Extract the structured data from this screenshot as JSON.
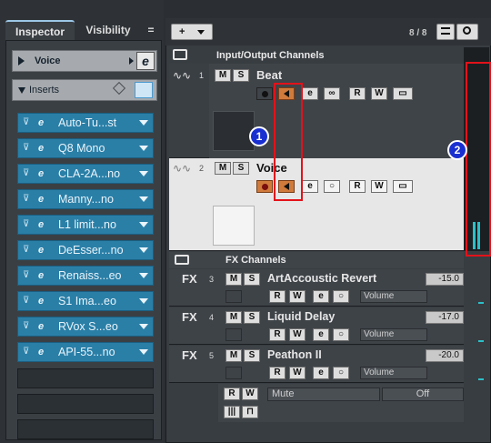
{
  "inspector": {
    "tabs": [
      "Inspector",
      "Visibility"
    ],
    "menu_glyph": "=",
    "track_label": "Voice",
    "inserts_label": "Inserts",
    "inserts": [
      "Auto-Tu...st",
      "Q8 Mono",
      "CLA-2A...no",
      "Manny...no",
      "L1 limit...no",
      "DeEsser...no",
      "Renaiss...eo",
      "S1 Ima...eo",
      "RVox S...eo",
      "API-55...no"
    ]
  },
  "toolbar": {
    "add_label": "+",
    "count": "8 / 8"
  },
  "folders": {
    "io": "Input/Output Channels",
    "fx": "FX Channels"
  },
  "tracks": [
    {
      "num": "1",
      "name": "Beat",
      "m": "M",
      "s": "S"
    },
    {
      "num": "2",
      "name": "Voice",
      "m": "M",
      "s": "S"
    }
  ],
  "fx_channels": [
    {
      "num": "3",
      "badge": "FX",
      "name": "ArtAccoustic Revert",
      "value": "-15.0",
      "vol": "Volume"
    },
    {
      "num": "4",
      "badge": "FX",
      "name": "Liquid Delay",
      "value": "-17.0",
      "vol": "Volume"
    },
    {
      "num": "5",
      "badge": "FX",
      "name": "Peathon II",
      "value": "-20.0",
      "vol": "Volume"
    }
  ],
  "footer": {
    "mute_label": "Mute",
    "off_label": "Off"
  },
  "annotations": [
    "1",
    "2"
  ],
  "colors": {
    "insert_blue": "#2a7fa7",
    "highlight_red": "#e3121a",
    "bubble_blue": "#1a2fd0",
    "monitor_orange": "#d07a3c",
    "meter_cyan": "#2cc0c8"
  }
}
